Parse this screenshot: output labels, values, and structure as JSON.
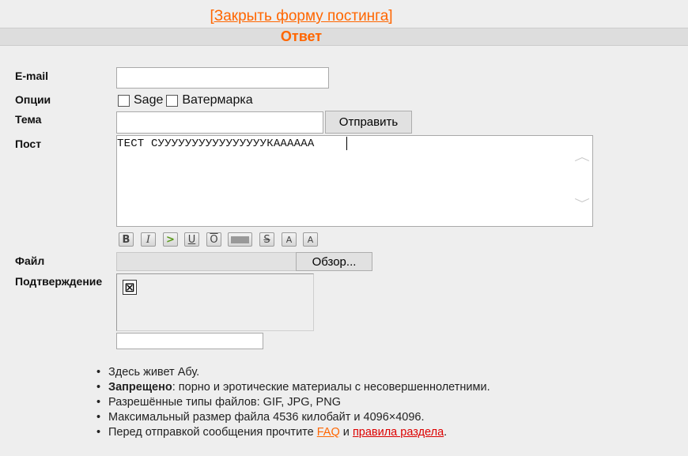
{
  "header": {
    "close_form": "[Закрыть форму постинга]",
    "reply_title": "Ответ"
  },
  "form": {
    "email_label": "E-mail",
    "email_value": "",
    "options_label": "Опции",
    "option_sage": "Sage",
    "option_sage_checked": false,
    "option_watermark": "Ватермарка",
    "option_watermark_checked": false,
    "subject_label": "Тема",
    "subject_value": "",
    "submit_label": "Отправить",
    "post_label": "Пост",
    "post_value": "ТЕСТ СУУУУУУУУУУУУУУУУКАААААА",
    "file_label": "Файл",
    "browse_label": "Обзор...",
    "captcha_label": "Подтверждение",
    "captcha_value": ""
  },
  "format_toolbar": [
    {
      "icon": "bold-icon",
      "glyph": "B"
    },
    {
      "icon": "italic-icon",
      "glyph": "I"
    },
    {
      "icon": "quote-icon",
      "glyph": ">"
    },
    {
      "icon": "underline-icon",
      "glyph": "U"
    },
    {
      "icon": "overline-icon",
      "glyph": "O"
    },
    {
      "icon": "spoiler-icon",
      "glyph": ""
    },
    {
      "icon": "strikethrough-icon",
      "glyph": "S"
    },
    {
      "icon": "superscript-icon",
      "glyph": "A"
    },
    {
      "icon": "subscript-icon",
      "glyph": "A"
    }
  ],
  "info": {
    "line1": "Здесь живет Абу.",
    "line2_bold": "Запрещено",
    "line2_rest": ": порно и эротические материалы с несовершеннолетними.",
    "line3": "Разрешённые типы файлов: GIF, JPG, PNG",
    "line4": "Максимальный размер файла 4536 килобайт и 4096×4096.",
    "line5_prefix": "Перед отправкой сообщения прочтите ",
    "faq_link": "FAQ",
    "line5_mid": " и ",
    "rules_link": "правила раздела",
    "line5_suffix": "."
  },
  "colors": {
    "accent": "#ff6600",
    "rules_link": "#dd0000",
    "background": "#eeeeee"
  }
}
